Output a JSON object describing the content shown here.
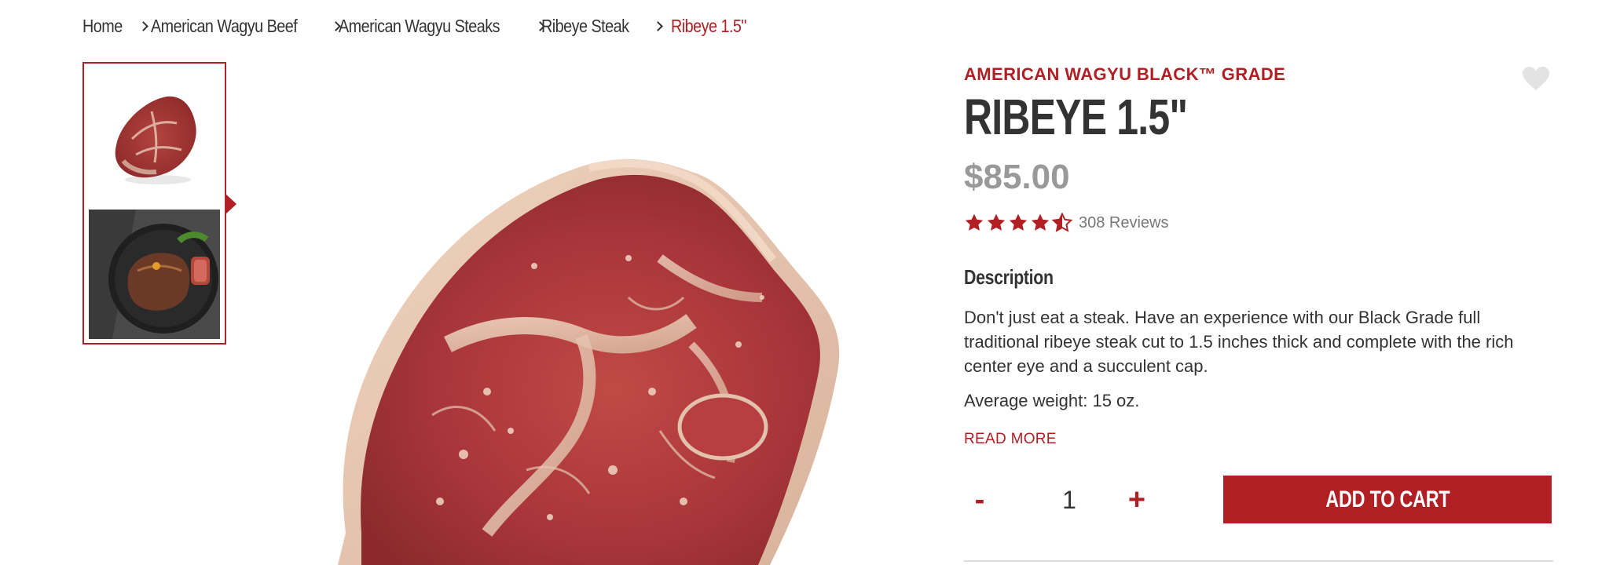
{
  "breadcrumb": {
    "items": [
      {
        "label": "Home"
      },
      {
        "label": "American Wagyu Beef"
      },
      {
        "label": "American Wagyu Steaks"
      },
      {
        "label": "Ribeye Steak"
      },
      {
        "label": "Ribeye 1.5\""
      }
    ]
  },
  "gallery": {
    "thumbnails": [
      {
        "icon": "raw-steak-image"
      },
      {
        "icon": "plated-steak-image"
      }
    ],
    "main_image_icon": "raw-ribeye-image"
  },
  "product": {
    "grade": "AMERICAN WAGYU BLACK™ GRADE",
    "title": "RIBEYE 1.5\"",
    "price": "$85.00",
    "rating": 4.5,
    "reviews": "308 Reviews",
    "description_heading": "Description",
    "description": "Don't just eat a steak. Have an experience with our Black Grade full traditional ribeye steak cut to 1.5 inches thick and complete with the rich center eye and a succulent cap.",
    "weight": "Average weight: 15 oz.",
    "read_more": "READ MORE"
  },
  "purchase": {
    "minus_label": "-",
    "plus_label": "+",
    "quantity": "1",
    "add_to_cart": "ADD TO CART"
  },
  "colors": {
    "accent": "#b01f24",
    "price": "#999999",
    "text": "#333333"
  }
}
